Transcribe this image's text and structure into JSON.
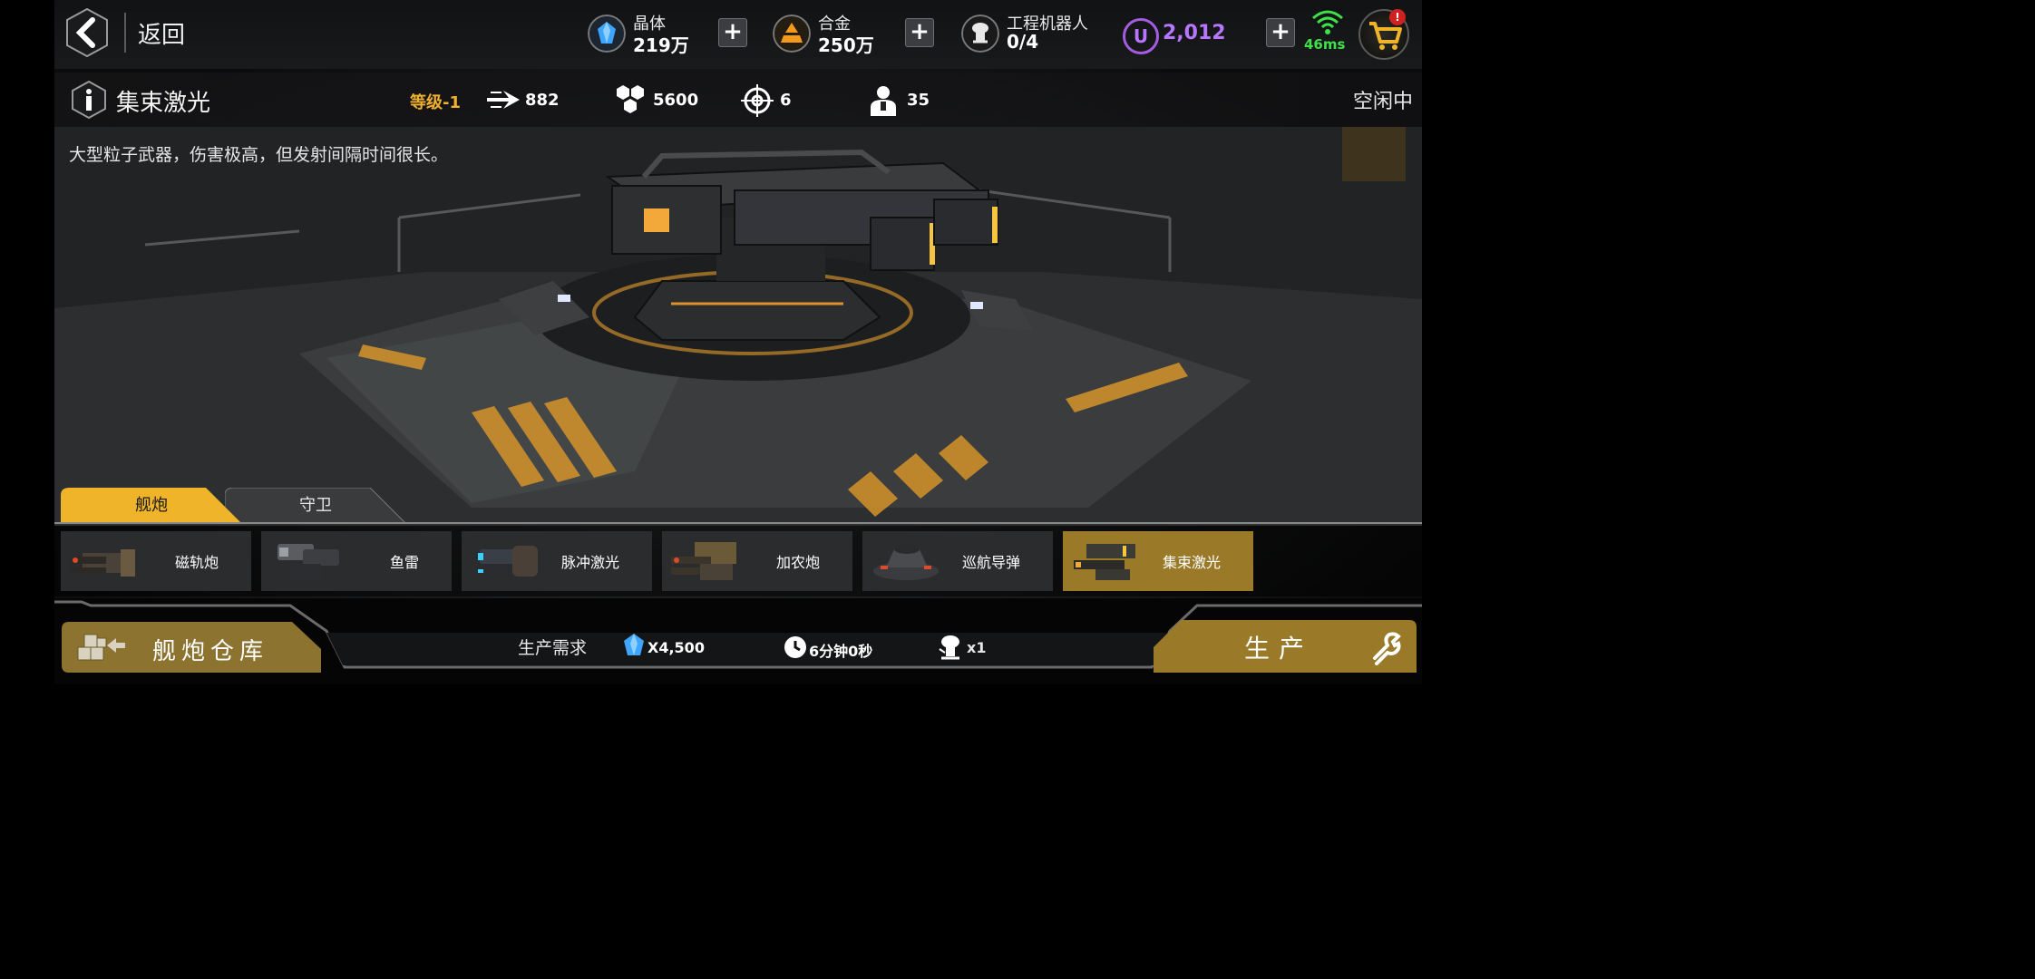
{
  "header": {
    "back_label": "返回",
    "resources": [
      {
        "name": "晶体",
        "value": "219万"
      },
      {
        "name": "合金",
        "value": "250万"
      },
      {
        "name": "工程机器人",
        "value": "0/4"
      }
    ],
    "currency_value": "2,012",
    "currency_symbol": "U",
    "ping": "46ms",
    "cart_badge": "!"
  },
  "weapon": {
    "title": "集束激光",
    "level": "等级-1",
    "stats": {
      "damage": "882",
      "hp": "5600",
      "range": "6",
      "crew": "35"
    },
    "status": "空闲中",
    "description": "大型粒子武器，伤害极高，但发射间隔时间很长。"
  },
  "tabs": [
    {
      "label": "舰炮",
      "active": true
    },
    {
      "label": "守卫",
      "active": false
    }
  ],
  "weapons_list": [
    {
      "label": "磁轨炮",
      "active": false
    },
    {
      "label": "鱼雷",
      "active": false
    },
    {
      "label": "脉冲激光",
      "active": false
    },
    {
      "label": "加农炮",
      "active": false
    },
    {
      "label": "巡航导弹",
      "active": false
    },
    {
      "label": "集束激光",
      "active": true
    }
  ],
  "footer": {
    "warehouse_label": "舰炮仓库",
    "requirement_label": "生产需求",
    "crystal_cost": "X4,500",
    "time_cost": "6分钟0秒",
    "robot_cost": "x1",
    "produce_label": "生产"
  },
  "colors": {
    "accent_gold": "#f0b42a",
    "active_item": "#9a7a28",
    "currency_purple": "#b676ff",
    "ping_green": "#3fe04a"
  }
}
